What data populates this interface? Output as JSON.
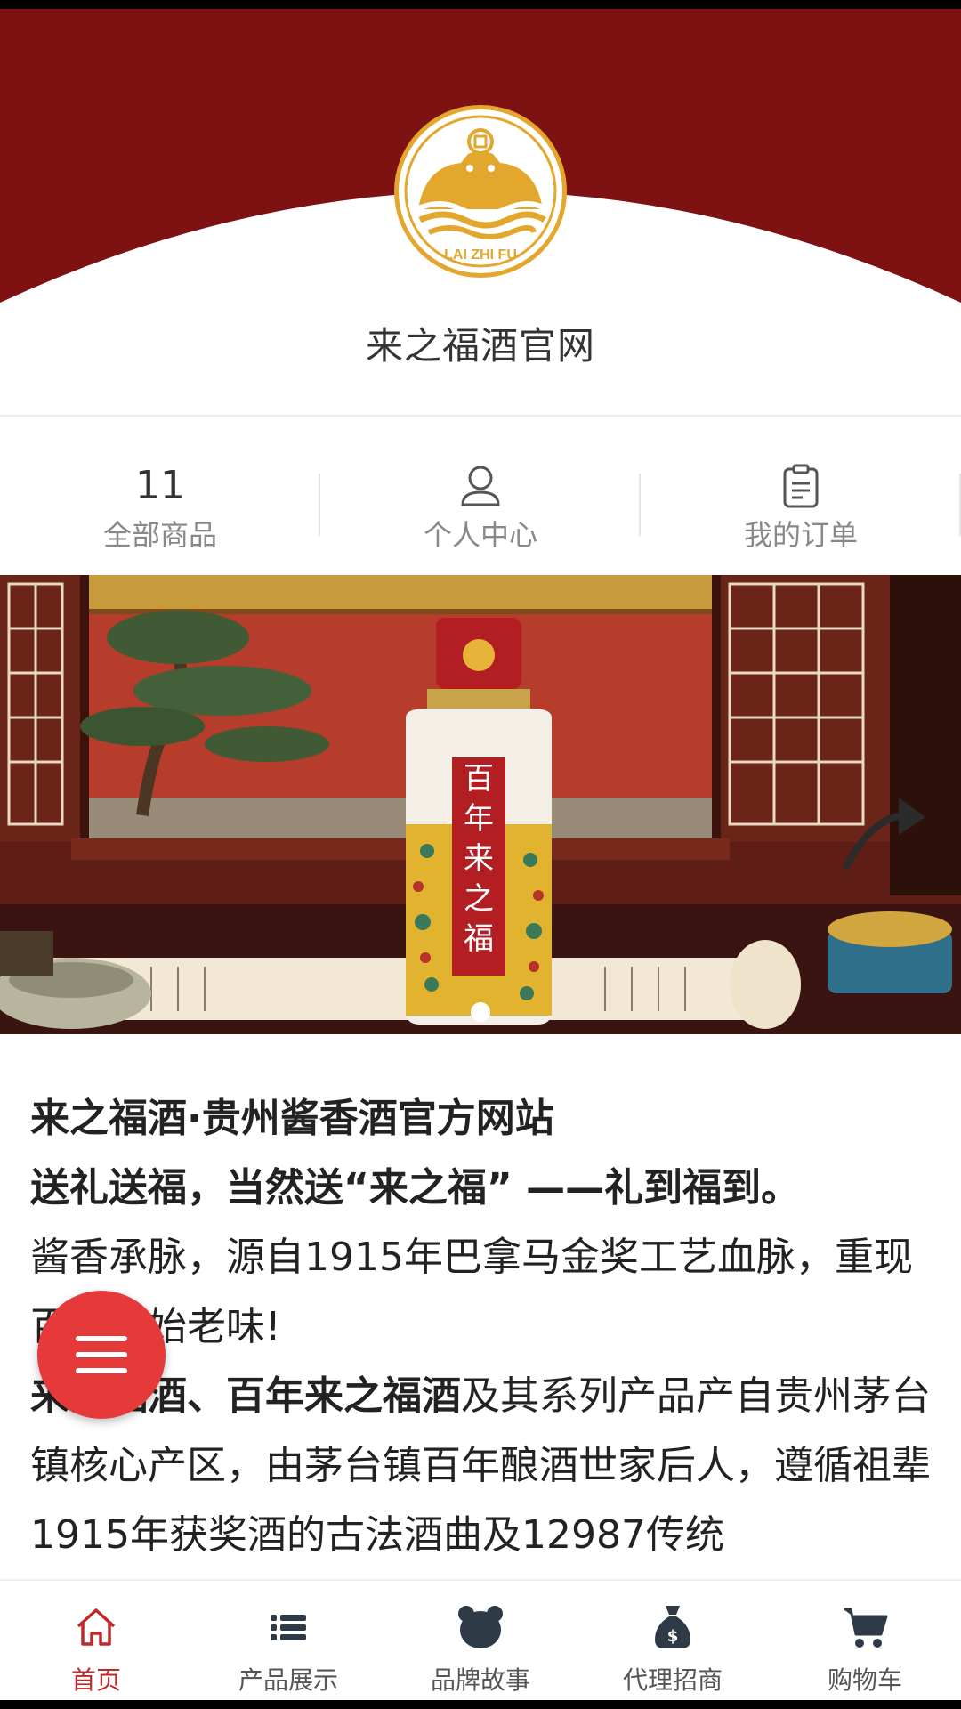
{
  "header": {
    "site_title": "来之福酒官网",
    "logo_text": "LAI ZHI FU",
    "brand_color": "#7e1213",
    "logo_color": "#e3a72d"
  },
  "stats": [
    {
      "value": "11",
      "label": "全部商品"
    },
    {
      "icon": "user-icon",
      "label": "个人中心"
    },
    {
      "icon": "clipboard-icon",
      "label": "我的订单"
    }
  ],
  "banner": {
    "bottle_label": "百年来之福",
    "slides_count": 1,
    "active_slide": 1
  },
  "article": {
    "line1": "来之福酒·贵州酱香酒官方网站",
    "line2": "送礼送福，当然送“来之福” ——礼到福到。",
    "para1": "酱香承脉，源自1915年巴拿马金奖工艺血脉，重现百年原始老味!",
    "para2_bold": "来之福酒、百年来之福酒",
    "para2_rest": "及其系列产品产自贵州茅台镇核心产区，由茅台镇百年酿酒世家后人，遵循祖辈1915年获奖酒的古法酒曲及12987传统"
  },
  "tabbar": {
    "items": [
      {
        "label": "首页",
        "icon": "home-icon",
        "active": true
      },
      {
        "label": "产品展示",
        "icon": "list-icon",
        "active": false
      },
      {
        "label": "品牌故事",
        "icon": "bear-icon",
        "active": false
      },
      {
        "label": "代理招商",
        "icon": "money-bag-icon",
        "active": false
      },
      {
        "label": "购物车",
        "icon": "cart-icon",
        "active": false
      }
    ],
    "active_color": "#c0282a"
  }
}
